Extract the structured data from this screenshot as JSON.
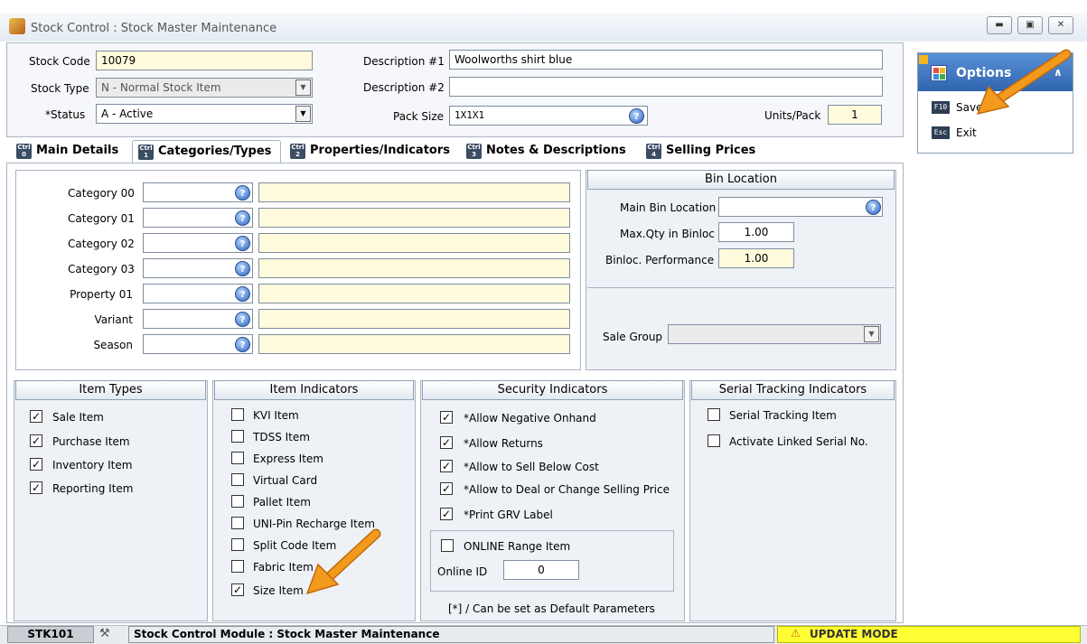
{
  "window": {
    "title": "Stock Control : Stock Master Maintenance"
  },
  "header": {
    "stock_code_label": "Stock Code",
    "stock_code": "10079",
    "stock_type_label": "Stock Type",
    "stock_type": "N - Normal Stock Item",
    "status_label": "*Status",
    "status": "A - Active",
    "desc1_label": "Description #1",
    "desc1": "Woolworths shirt blue",
    "desc2_label": "Description #2",
    "desc2": "",
    "pack_size_label": "Pack Size",
    "pack_size": "1X1X1",
    "units_pack_label": "Units/Pack",
    "units_pack": "1"
  },
  "tabs": [
    {
      "label": "Main Details",
      "key": "0"
    },
    {
      "label": "Categories/Types",
      "key": "1"
    },
    {
      "label": "Properties/Indicators",
      "key": "2"
    },
    {
      "label": "Notes & Descriptions",
      "key": "3"
    },
    {
      "label": "Selling Prices",
      "key": "4"
    }
  ],
  "categories": [
    {
      "label": "Category 00"
    },
    {
      "label": "Category 01"
    },
    {
      "label": "Category 02"
    },
    {
      "label": "Category 03"
    },
    {
      "label": "Property 01"
    },
    {
      "label": "Variant"
    },
    {
      "label": "Season"
    }
  ],
  "bin_location": {
    "title": "Bin Location",
    "main_bin_label": "Main Bin Location",
    "main_bin": "",
    "max_qty_label": "Max.Qty in Binloc",
    "max_qty": "1.00",
    "performance_label": "Binloc. Performance",
    "performance": "1.00",
    "sale_group_label": "Sale Group",
    "sale_group": ""
  },
  "item_types": {
    "title": "Item Types",
    "items": [
      {
        "label": "Sale Item",
        "checked": true
      },
      {
        "label": "Purchase Item",
        "checked": true
      },
      {
        "label": "Inventory Item",
        "checked": true
      },
      {
        "label": "Reporting Item",
        "checked": true
      }
    ]
  },
  "item_indicators": {
    "title": "Item Indicators",
    "items": [
      {
        "label": "KVI Item",
        "checked": false
      },
      {
        "label": "TDSS Item",
        "checked": false
      },
      {
        "label": "Express Item",
        "checked": false
      },
      {
        "label": "Virtual Card",
        "checked": false
      },
      {
        "label": "Pallet Item",
        "checked": false
      },
      {
        "label": "UNI-Pin Recharge Item",
        "checked": false
      },
      {
        "label": "Split Code Item",
        "checked": false
      },
      {
        "label": "Fabric Item",
        "checked": false
      },
      {
        "label": "Size Item",
        "checked": true
      }
    ]
  },
  "security_indicators": {
    "title": "Security Indicators",
    "items": [
      {
        "label": "*Allow Negative Onhand",
        "checked": true
      },
      {
        "label": "*Allow Returns",
        "checked": true
      },
      {
        "label": "*Allow to Sell Below Cost",
        "checked": true
      },
      {
        "label": "*Allow to Deal or Change Selling Price",
        "checked": true
      },
      {
        "label": "*Print GRV Label",
        "checked": true
      }
    ],
    "online_range_label": "ONLINE Range Item",
    "online_id_label": "Online ID",
    "online_id": "0",
    "footnote": "[*] / Can be set as Default Parameters"
  },
  "serial_tracking": {
    "title": "Serial Tracking Indicators",
    "items": [
      {
        "label": "Serial Tracking Item",
        "checked": false
      },
      {
        "label": "Activate Linked Serial No.",
        "checked": false
      }
    ]
  },
  "options": {
    "title": "Options",
    "save_key": "F10",
    "save_label": "Save",
    "exit_key": "Esc",
    "exit_label": "Exit"
  },
  "statusbar": {
    "code": "STK101",
    "module": "Stock Control Module : Stock Master Maintenance",
    "mode": "UPDATE MODE"
  },
  "colors": {
    "accent_blue": "#2a64c2",
    "input_yellow": "#fffbdc",
    "mode_yellow": "#ffff33",
    "annotation_arrow": "#f39a1e"
  }
}
